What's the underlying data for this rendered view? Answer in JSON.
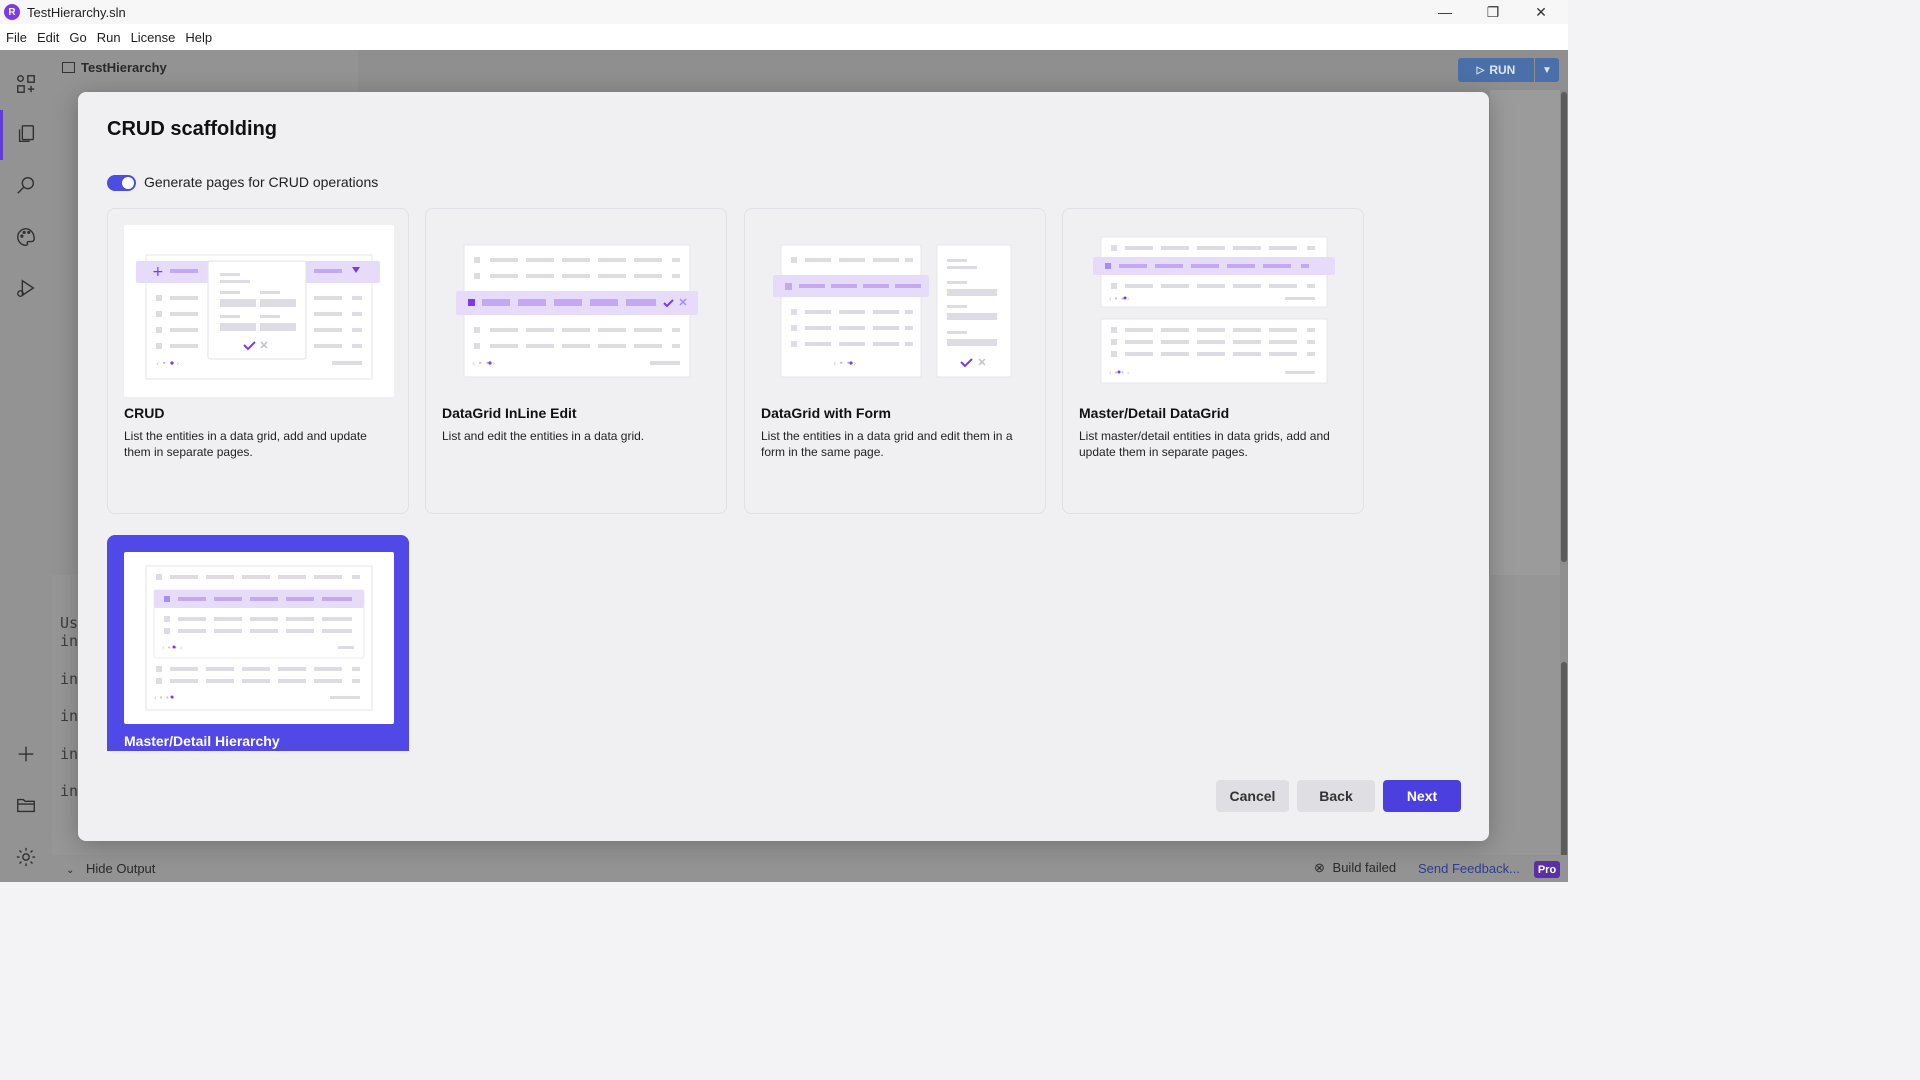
{
  "window": {
    "title": "TestHierarchy.sln",
    "logo_letter": "R",
    "minimize_glyph": "—",
    "restore_glyph": "❐",
    "close_glyph": "✕"
  },
  "menu": [
    "File",
    "Edit",
    "Go",
    "Run",
    "License",
    "Help"
  ],
  "project": {
    "name": "TestHierarchy"
  },
  "toolbar": {
    "run_label": "RUN"
  },
  "background_code": [
    "Us",
    "in",
    "in",
    "in",
    "in",
    "in"
  ],
  "status": {
    "hide_output": "Hide Output",
    "build": "Build failed",
    "feedback": "Send Feedback...",
    "badge": "Pro"
  },
  "dialog": {
    "title": "CRUD scaffolding",
    "toggle_label": "Generate pages for CRUD operations",
    "toggle_on": true,
    "cards": [
      {
        "title": "CRUD",
        "description": "List the entities in a data grid, add and update them in separate pages.",
        "selected": false
      },
      {
        "title": "DataGrid InLine Edit",
        "description": "List and edit the entities in a data grid.",
        "selected": false
      },
      {
        "title": "DataGrid with Form",
        "description": "List the entities in a data grid and edit them in a form in the same page.",
        "selected": false
      },
      {
        "title": "Master/Detail DataGrid",
        "description": "List master/detail entities in data grids, add and update them in separate pages.",
        "selected": false
      },
      {
        "title": "Master/Detail Hierarchy",
        "description": "",
        "selected": true
      }
    ],
    "buttons": {
      "cancel": "Cancel",
      "back": "Back",
      "next": "Next"
    }
  },
  "colors": {
    "accent": "#4b3fe0",
    "selected_card": "#5148e8",
    "preview_highlight": "#e6dcfa",
    "preview_bar": "#c4a8f2"
  }
}
